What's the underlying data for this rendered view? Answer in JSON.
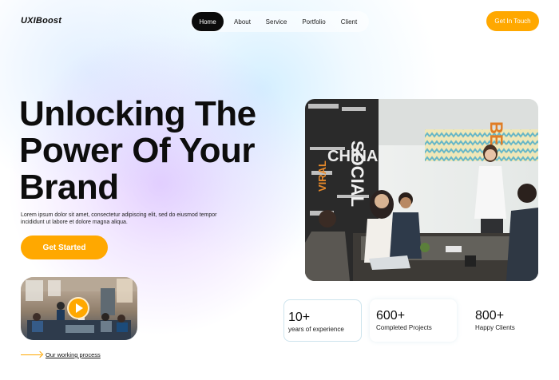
{
  "brand": {
    "logo": "UXIBoost"
  },
  "nav": {
    "items": [
      "Home",
      "About",
      "Service",
      "Portfolio",
      "Client"
    ],
    "active": "Home"
  },
  "header": {
    "cta_label": "Get In Touch"
  },
  "hero": {
    "headline": [
      "Unlocking The",
      "Power Of Your",
      "Brand"
    ],
    "description": "Lorem ipsum dolor sit amet, consectetur adipiscing elit, sed do eiusmod tempor incididunt ut labore et dolore magna aliqua.",
    "cta_label": "Get Started",
    "process_link": "Our working process"
  },
  "stats": [
    {
      "value": "10+",
      "label": "years of experience"
    },
    {
      "value": "600+",
      "label": "Completed Projects"
    },
    {
      "value": "800+",
      "label": "Happy Clients"
    }
  ],
  "photo_text": {
    "wall_words": [
      "SOCIAL",
      "CHINA",
      "VIRAL"
    ],
    "orange_lettering": "BE"
  },
  "colors": {
    "accent": "#ffa800",
    "nav_active": "#0b0b0b",
    "text": "#0d0d0d"
  },
  "icons": {
    "play": "play-icon",
    "arrow": "arrow-right-icon"
  }
}
